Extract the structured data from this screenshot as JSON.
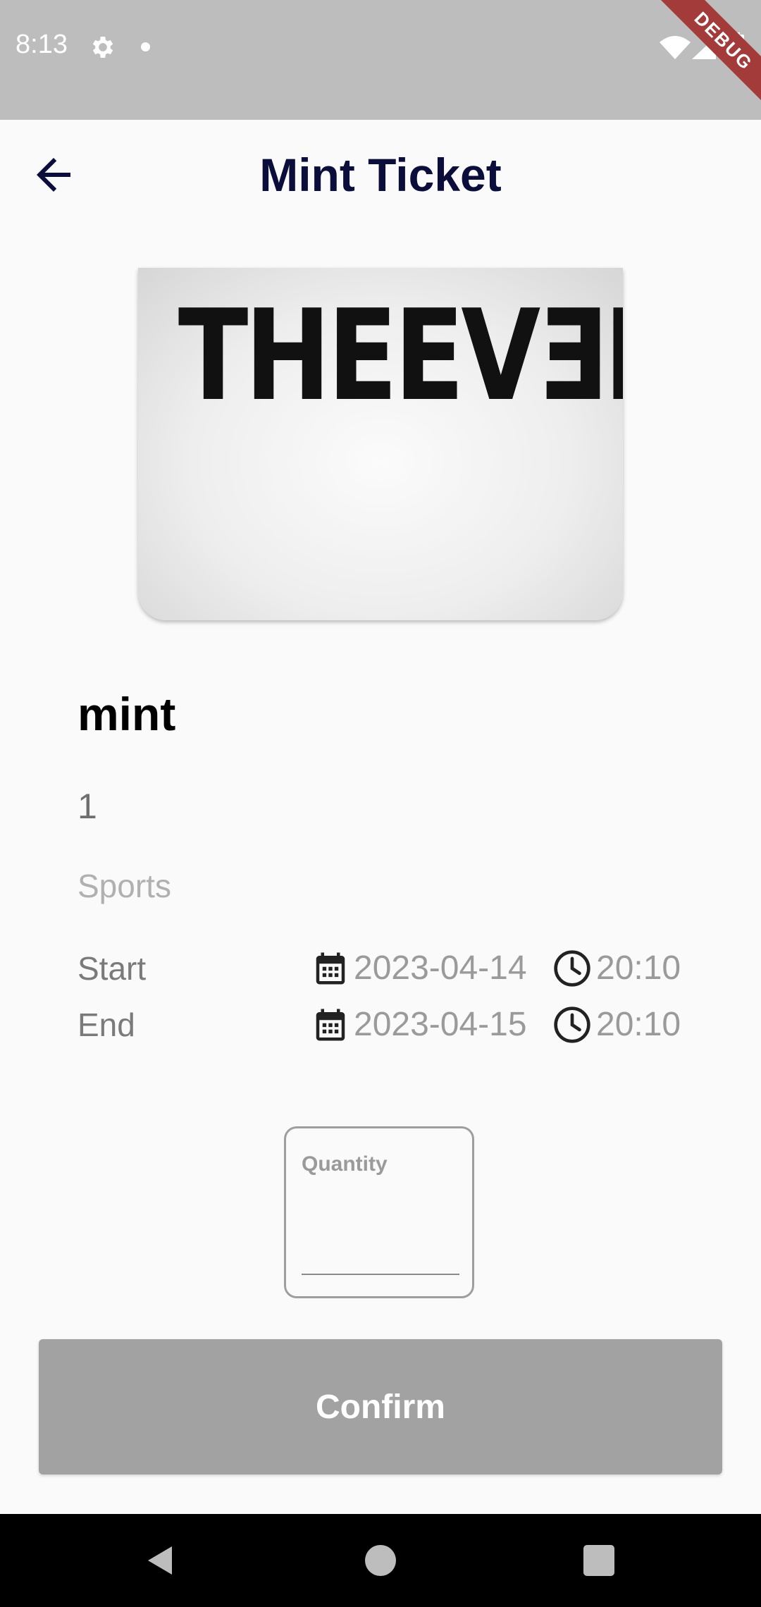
{
  "status_bar": {
    "time": "8:13",
    "debug_label": "DEBUG",
    "icons": [
      "gear-icon",
      "dot-icon",
      "wifi-icon",
      "signal-icon",
      "battery-icon"
    ]
  },
  "app_bar": {
    "title": "Mint Ticket",
    "back_icon": "arrow-left-icon"
  },
  "event": {
    "image_text": "THEEVƎNT",
    "name": "mint",
    "price": "1",
    "category": "Sports",
    "start": {
      "label": "Start",
      "date": "2023-04-14",
      "time": "20:10"
    },
    "end": {
      "label": "End",
      "date": "2023-04-15",
      "time": "20:10"
    }
  },
  "form": {
    "quantity_label": "Quantity",
    "quantity_value": ""
  },
  "actions": {
    "confirm_label": "Confirm"
  },
  "colors": {
    "title": "#0b0d3a",
    "status_bar": "#bdbdbd",
    "button_disabled": "#a2a2a2",
    "debug_banner": "#a33b3b"
  },
  "nav": {
    "icons": [
      "back-triangle-icon",
      "home-circle-icon",
      "recents-square-icon"
    ]
  }
}
